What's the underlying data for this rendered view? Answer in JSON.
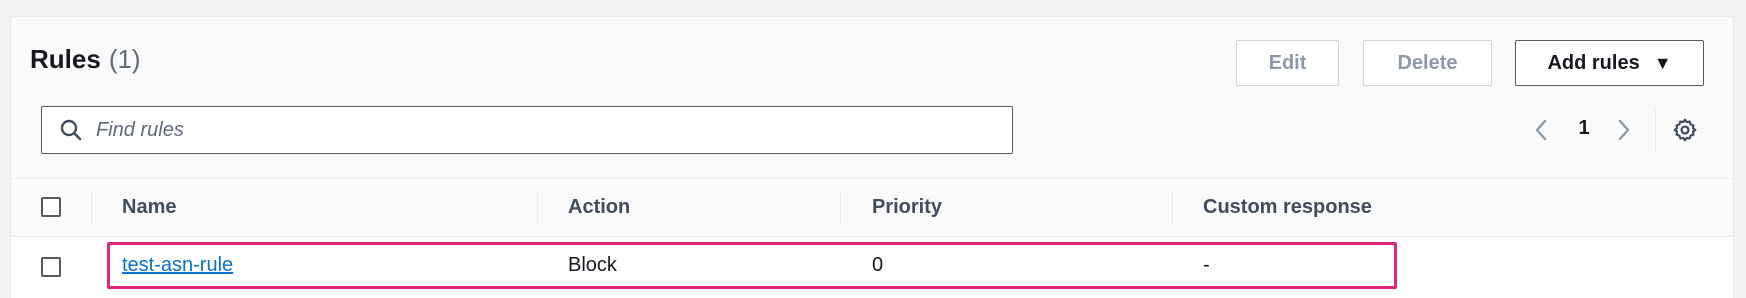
{
  "header": {
    "title": "Rules",
    "count": "(1)"
  },
  "actions": {
    "edit_label": "Edit",
    "delete_label": "Delete",
    "add_label": "Add rules",
    "add_caret": "▼"
  },
  "search": {
    "placeholder": "Find rules",
    "value": ""
  },
  "pagination": {
    "prev": "‹",
    "current_page": "1",
    "next": "›"
  },
  "table": {
    "columns": [
      "Name",
      "Action",
      "Priority",
      "Custom response"
    ],
    "rows": [
      {
        "name": "test-asn-rule",
        "action": "Block",
        "priority": "0",
        "custom_response": "-"
      }
    ]
  },
  "icons": {
    "search": "search-icon",
    "settings": "gear-icon"
  },
  "colors": {
    "link": "#0972d3",
    "highlight": "#e0267d",
    "border_dark": "#545b64"
  }
}
